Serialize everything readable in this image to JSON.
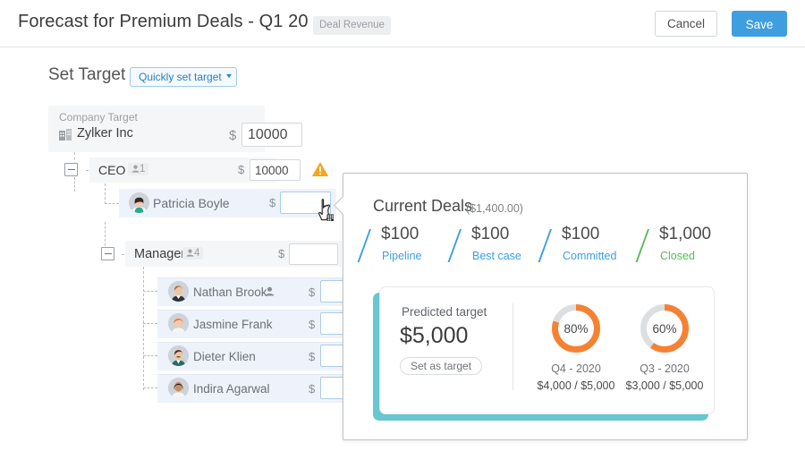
{
  "header": {
    "title": "Forecast for Premium Deals - Q1 20",
    "badge": "Deal Revenue",
    "cancel_label": "Cancel",
    "save_label": "Save",
    "save_color": "#3f9ee0"
  },
  "set_target": {
    "heading": "Set Target",
    "quick_button": "Quickly set target",
    "company": {
      "label": "Company Target",
      "name": "Zylker Inc",
      "currency": "$",
      "value": "10000"
    },
    "ceo": {
      "label": "CEO",
      "count": "1",
      "currency": "$",
      "value": "10000",
      "warning": true
    },
    "ceo_person": {
      "name": "Patricia Boyle",
      "currency": "$",
      "value": ""
    },
    "manager": {
      "label": "Manager",
      "count": "4",
      "currency": "$",
      "value": ""
    },
    "members": [
      {
        "name": "Nathan Brook",
        "currency": "$",
        "value": "",
        "has_tag": true
      },
      {
        "name": "Jasmine Frank",
        "currency": "$",
        "value": "",
        "has_tag": false
      },
      {
        "name": "Dieter Klien",
        "currency": "$",
        "value": "",
        "has_tag": false
      },
      {
        "name": "Indira Agarwal",
        "currency": "$",
        "value": "",
        "has_tag": false
      }
    ]
  },
  "popup": {
    "deals_title": "Current Deals",
    "deals_total": "($1,400.00)",
    "metrics": [
      {
        "value": "$100",
        "label": "Pipeline",
        "color": "#3f9ee0"
      },
      {
        "value": "$100",
        "label": "Best case",
        "color": "#3f9ee0"
      },
      {
        "value": "$100",
        "label": "Committed",
        "color": "#3f9ee0"
      },
      {
        "value": "$1,000",
        "label": "Closed",
        "color": "#5cb85c"
      }
    ],
    "predicted": {
      "label": "Predicted target",
      "value": "$5,000",
      "button": "Set as target"
    },
    "donuts": [
      {
        "percent": "80%",
        "pct_num": 80,
        "period": "Q4 - 2020",
        "amount": "$4,000 / $5,000"
      },
      {
        "percent": "60%",
        "pct_num": 60,
        "period": "Q3 - 2020",
        "amount": "$3,000 / $5,000"
      }
    ],
    "accent_color": "#f58233",
    "shadow_color": "#67c7d2"
  }
}
